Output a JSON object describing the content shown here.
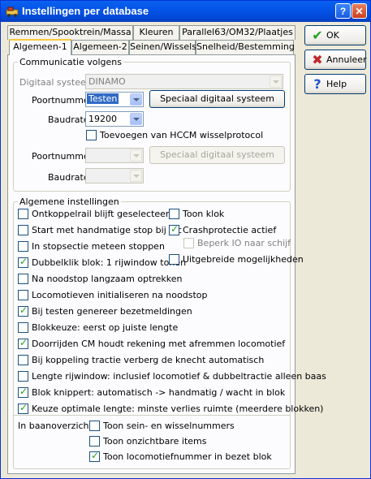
{
  "window": {
    "title": "Instellingen per database",
    "help_glyph": "?",
    "close_glyph": "✕"
  },
  "tabs_row1": [
    "Remmen/Spooktrein/Massa",
    "Kleuren",
    "Parallel63/OM32/Plaatjes"
  ],
  "tabs_row2": [
    "Algemeen-1",
    "Algemeen-2",
    "Seinen/Wissels",
    "Snelheid/Bestemming"
  ],
  "active_tab": "Algemeen-1",
  "communicatie": {
    "legend": "Communicatie volgens",
    "digitaal_label": "Digitaal systeem",
    "digitaal_value": "DINAMO",
    "poort1_label": "Poortnummer",
    "poort1_value": "Testen",
    "special1_label": "Speciaal digitaal systeem",
    "baud1_label": "Baudrate",
    "baud1_value": "19200",
    "hccm_label": "Toevoegen van HCCM wisselprotocol",
    "hccm_checked": false,
    "poort2_label": "Poortnummer",
    "poort2_value": "",
    "special2_label": "Speciaal digitaal systeem",
    "baud2_label": "Baudrate",
    "baud2_value": ""
  },
  "algemeen": {
    "legend": "Algemene instellingen",
    "left": [
      {
        "label": "Ontkoppelrail blijft geselecteerd",
        "checked": false
      },
      {
        "label": "Start met handmatige stop bij loc",
        "checked": false
      },
      {
        "label": "In stopsectie meteen stoppen",
        "checked": false
      },
      {
        "label": "Dubbelklik blok: 1 rijwindow tonen",
        "checked": true
      },
      {
        "label": "Na noodstop langzaam optrekken",
        "checked": false
      },
      {
        "label": "Locomotieven initialiseren na noodstop",
        "checked": false
      },
      {
        "label": "Bij testen genereer bezetmeldingen",
        "checked": true
      },
      {
        "label": "Blokkeuze: eerst op juiste lengte",
        "checked": false
      },
      {
        "label": "Doorrijden CM houdt rekening met afremmen locomotief",
        "checked": true
      },
      {
        "label": "Bij koppeling tractie verberg de knecht automatisch",
        "checked": false
      },
      {
        "label": "Lengte rijwindow: inclusief locomotief & dubbeltractie alleen baas",
        "checked": false
      },
      {
        "label": "Blok knippert: automatisch -> handmatig / wacht in blok",
        "checked": true
      },
      {
        "label": "Keuze optimale lengte: minste verlies ruimte (meerdere blokken)",
        "checked": true
      }
    ],
    "right": [
      {
        "label": "Toon klok",
        "checked": false,
        "disabled": false
      },
      {
        "label": "Crashprotectie actief",
        "checked": true,
        "disabled": false
      },
      {
        "label": "Beperk IO naar schijf",
        "checked": false,
        "disabled": true
      },
      {
        "label": "Uitgebreide mogelijkheden",
        "checked": false,
        "disabled": false
      }
    ]
  },
  "baanoverzicht": {
    "label": "In baanoverzicht",
    "items": [
      {
        "label": "Toon sein- en wisselnummers",
        "checked": false
      },
      {
        "label": "Toon onzichtbare items",
        "checked": false
      },
      {
        "label": "Toon locomotiefnummer in bezet blok",
        "checked": true
      }
    ]
  },
  "buttons": {
    "ok": "OK",
    "annuleer": "Annuleer",
    "help": "Help"
  },
  "icons": {
    "ok": "checkmark-icon",
    "annuleer": "x-icon",
    "help": "question-icon"
  },
  "colors": {
    "title_bar": "#0454E8",
    "check": "#21A121",
    "cancel": "#C0262B",
    "help": "#1F56C9"
  }
}
